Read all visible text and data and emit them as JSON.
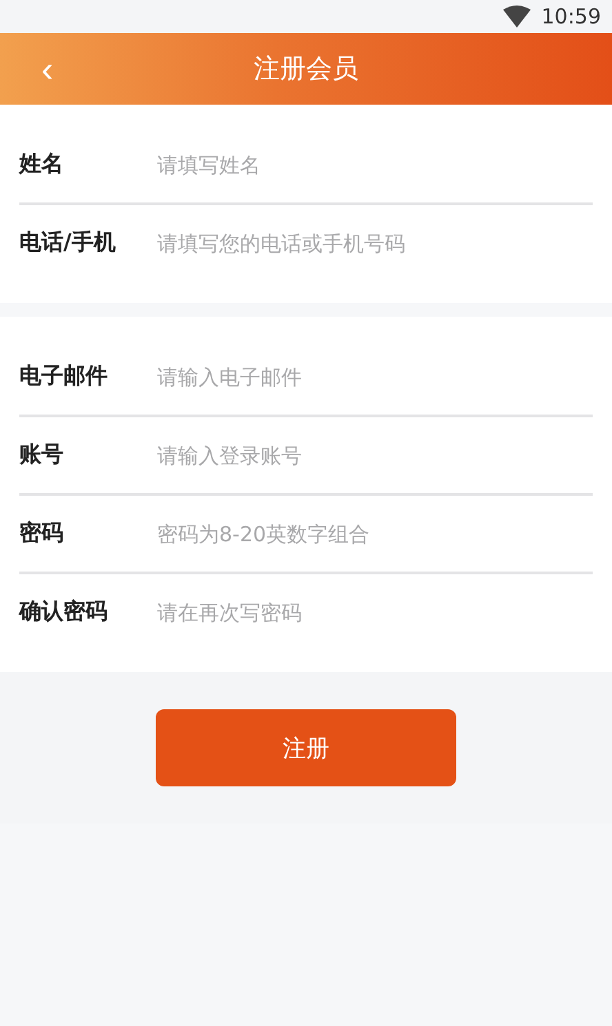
{
  "status_bar": {
    "time": "10:59"
  },
  "header": {
    "back": "‹",
    "title": "注册会员"
  },
  "sections": [
    {
      "fields": [
        {
          "label": "姓名",
          "placeholder": "请填写姓名"
        },
        {
          "label": "电话/手机",
          "placeholder": "请填写您的电话或手机号码"
        }
      ]
    },
    {
      "fields": [
        {
          "label": "电子邮件",
          "placeholder": "请输入电子邮件"
        },
        {
          "label": "账号",
          "placeholder": "请输入登录账号"
        },
        {
          "label": "密码",
          "placeholder": "密码为8-20英数字组合"
        },
        {
          "label": "确认密码",
          "placeholder": "请在再次写密码"
        }
      ]
    }
  ],
  "submit_button": "注册"
}
